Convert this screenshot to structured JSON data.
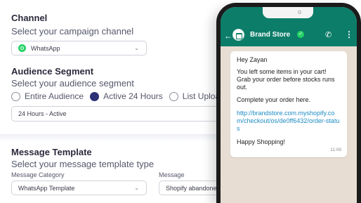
{
  "channel": {
    "title": "Channel",
    "subtitle": "Select your campaign channel",
    "selected": "WhatsApp"
  },
  "audience": {
    "title": "Audience Segment",
    "subtitle": "Select your audience segment",
    "options": [
      "Entire Audience",
      "Active 24 Hours",
      "List Upload"
    ],
    "selected_index": 1,
    "field_value": "24 Hours - Active"
  },
  "template": {
    "title": "Message Template",
    "subtitle": "Select your message template type",
    "category_label": "Message Category",
    "category_value": "WhatsApp Template",
    "message_label": "Message",
    "message_value": "Shopify abandoned c"
  },
  "phone": {
    "contact_name": "Brand Store",
    "greeting": "Hey Zayan",
    "body": "You left some items in your cart! Grab your order before stocks runs out.",
    "cta": "Complete your order here.",
    "link": "http://brandstore.com.myshopify.com/checkout/os/de0ff6432/order-status",
    "signoff": "Happy Shopping!",
    "time": "11:09"
  },
  "colors": {
    "whatsapp_header": "#0c7d69",
    "whatsapp_green": "#25d366",
    "radio_selected": "#2b3175",
    "link": "#1e8bc3",
    "chat_bg": "#e7ddd2"
  }
}
